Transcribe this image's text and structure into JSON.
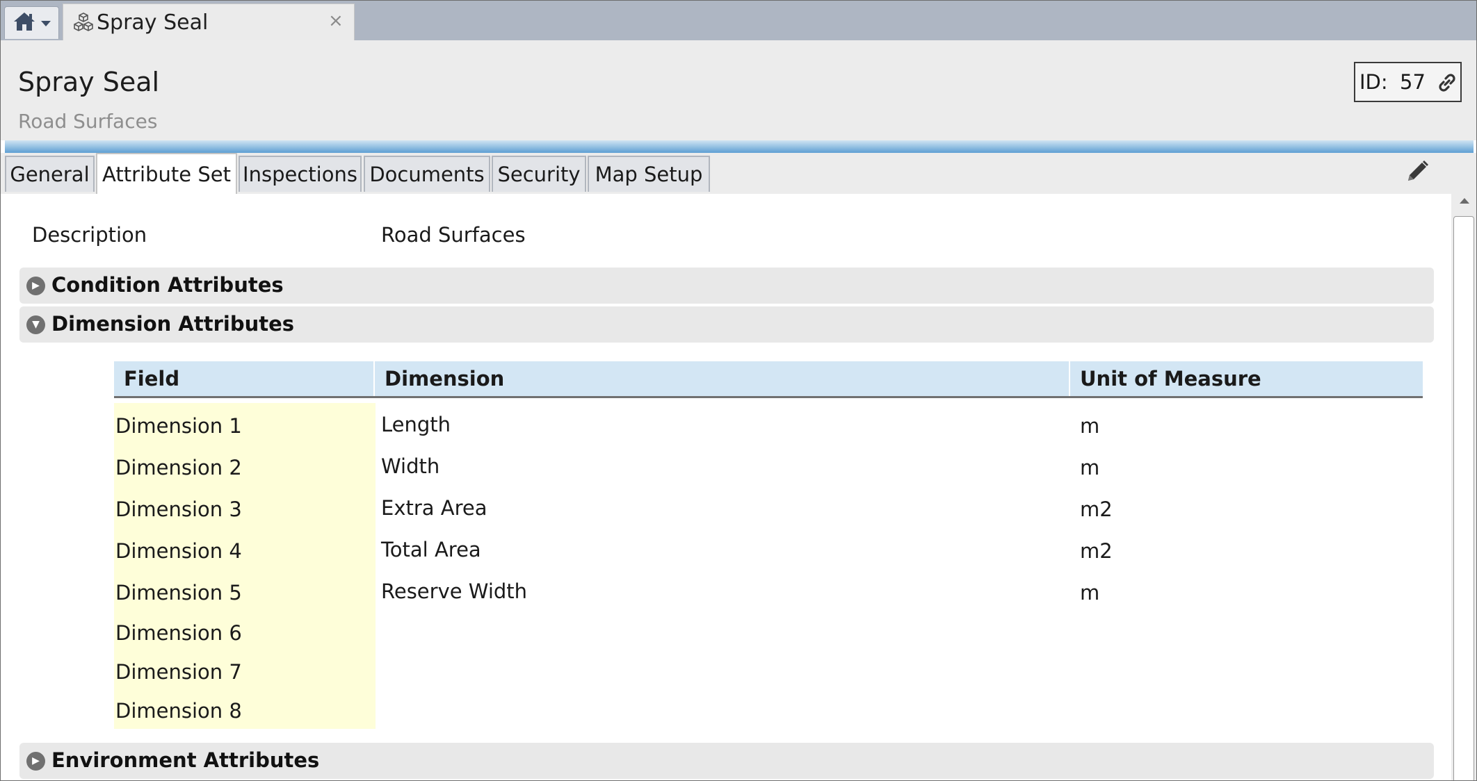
{
  "document_tab": {
    "title": "Spray Seal",
    "close_glyph": "×"
  },
  "header": {
    "title": "Spray Seal",
    "subtitle": "Road Surfaces",
    "id_label": "ID:",
    "id_value": "57"
  },
  "tabs": [
    {
      "label": "General"
    },
    {
      "label": "Attribute Set",
      "active": true
    },
    {
      "label": "Inspections"
    },
    {
      "label": "Documents"
    },
    {
      "label": "Security"
    },
    {
      "label": "Map Setup"
    }
  ],
  "description": {
    "label": "Description",
    "value": "Road Surfaces"
  },
  "sections": {
    "condition": {
      "title": "Condition Attributes",
      "expanded": false
    },
    "dimension": {
      "title": "Dimension Attributes",
      "expanded": true
    },
    "environment": {
      "title": "Environment Attributes",
      "expanded": false
    }
  },
  "dimension_table": {
    "headers": [
      "Field",
      "Dimension",
      "Unit of Measure"
    ],
    "rows": [
      {
        "field": "Dimension 1",
        "dimension": "Length",
        "unit": "m"
      },
      {
        "field": "Dimension 2",
        "dimension": "Width",
        "unit": "m"
      },
      {
        "field": "Dimension 3",
        "dimension": "Extra Area",
        "unit": "m2"
      },
      {
        "field": "Dimension 4",
        "dimension": "Total Area",
        "unit": "m2"
      },
      {
        "field": "Dimension 5",
        "dimension": "Reserve Width",
        "unit": "m"
      },
      {
        "field": "Dimension 6",
        "dimension": "",
        "unit": ""
      },
      {
        "field": "Dimension 7",
        "dimension": "",
        "unit": ""
      },
      {
        "field": "Dimension 8",
        "dimension": "",
        "unit": ""
      }
    ]
  },
  "icons": {
    "home": "home-icon",
    "tab_type": "cubes-icon",
    "id_link": "link-icon",
    "edit": "pencil-icon",
    "collapsed": "expand-arrow-icon",
    "expanded": "collapse-arrow-icon"
  },
  "colors": {
    "accent_bar": "#5e9fd3",
    "table_header": "#d3e6f4",
    "field_highlight": "#fefed9"
  }
}
